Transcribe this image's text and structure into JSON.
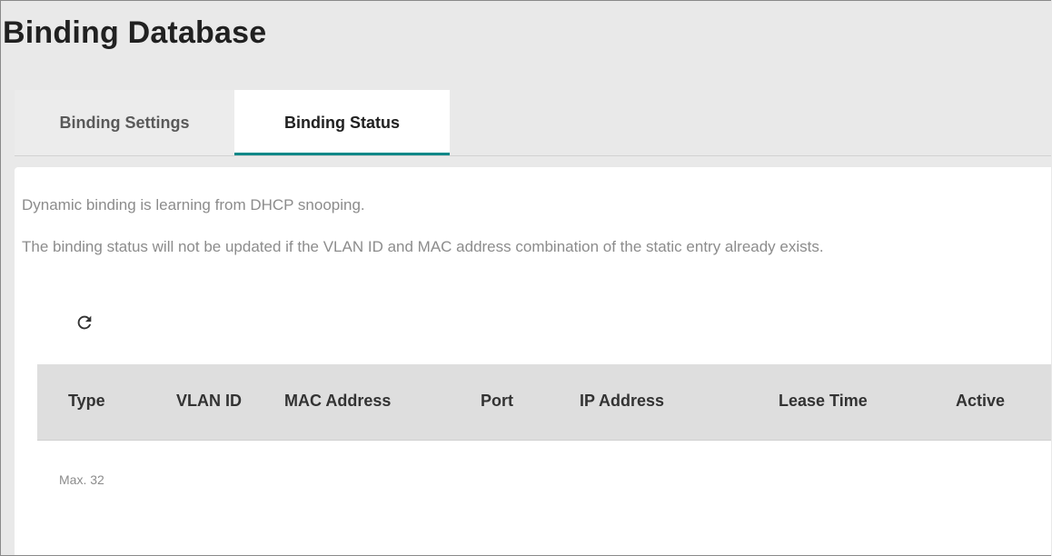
{
  "page": {
    "title": "Binding Database"
  },
  "tabs": [
    {
      "label": "Binding Settings",
      "active": false
    },
    {
      "label": "Binding Status",
      "active": true
    }
  ],
  "info": {
    "line1": "Dynamic binding is learning from DHCP snooping.",
    "line2": "The binding status will not be updated if the VLAN ID and MAC address combination of the static entry already exists."
  },
  "toolbar": {
    "refresh_icon": "refresh-icon"
  },
  "table": {
    "columns": [
      "Type",
      "VLAN ID",
      "MAC Address",
      "Port",
      "IP Address",
      "Lease Time",
      "Active"
    ],
    "rows": [],
    "max_label": "Max. 32"
  },
  "colors": {
    "accent": "#008787",
    "page_background": "#e9e9e9",
    "header_background": "#dedede",
    "muted_text": "#8c8c8c"
  }
}
